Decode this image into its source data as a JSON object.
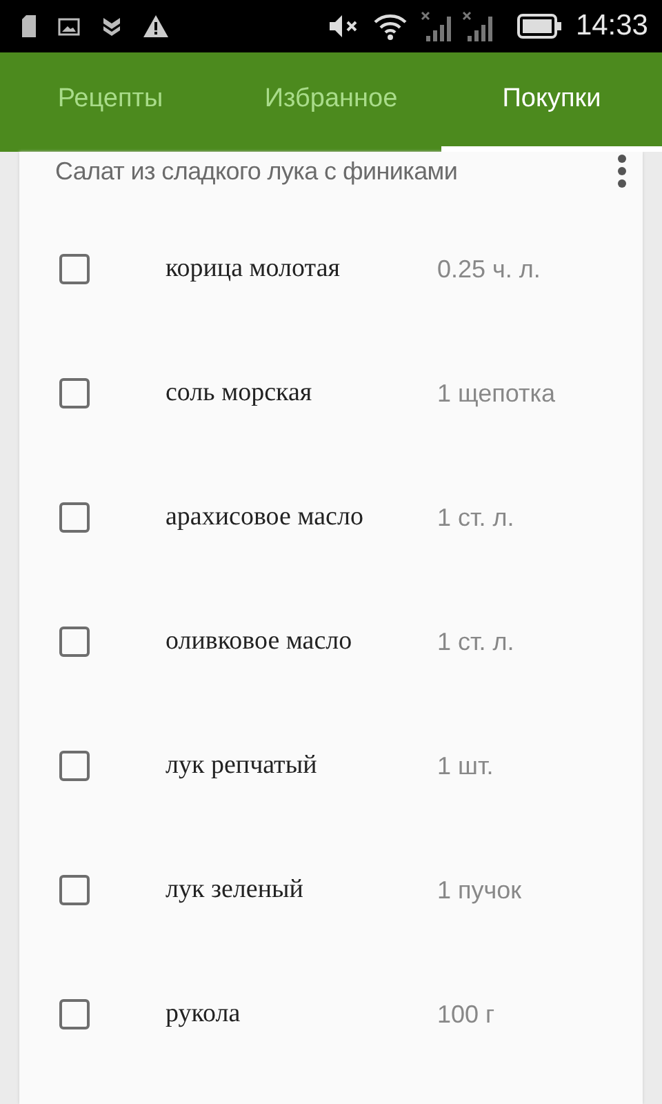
{
  "status_bar": {
    "time": "14:33"
  },
  "tabs": [
    {
      "label": "Рецепты",
      "selected": false
    },
    {
      "label": "Избранное",
      "selected": false
    },
    {
      "label": "Покупки",
      "selected": true
    }
  ],
  "recipe": {
    "title": "Салат из сладкого лука с финиками",
    "ingredients": [
      {
        "name": "корица молотая",
        "amount": "0.25 ч. л.",
        "checked": false
      },
      {
        "name": "соль морская",
        "amount": "1 щепотка",
        "checked": false
      },
      {
        "name": "арахисовое масло",
        "amount": "1 ст. л.",
        "checked": false
      },
      {
        "name": "оливковое масло",
        "amount": "1 ст. л.",
        "checked": false
      },
      {
        "name": "лук репчатый",
        "amount": "1 шт.",
        "checked": false
      },
      {
        "name": "лук зеленый",
        "amount": "1 пучок",
        "checked": false
      },
      {
        "name": "рукола",
        "amount": "100 г",
        "checked": false
      }
    ]
  }
}
